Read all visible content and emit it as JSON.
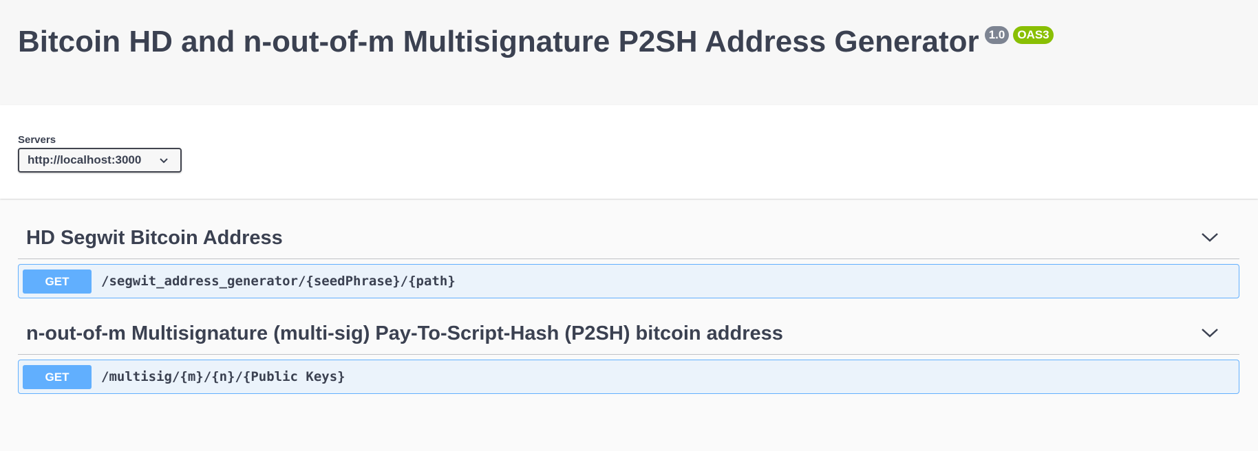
{
  "info": {
    "title": "Bitcoin HD and n-out-of-m Multisignature P2SH Address Generator",
    "version": "1.0",
    "spec_badge": "OAS3"
  },
  "servers": {
    "label": "Servers",
    "selected": "http://localhost:3000"
  },
  "tags": [
    {
      "name": "HD Segwit Bitcoin Address",
      "operations": [
        {
          "method": "GET",
          "path": "/segwit_address_generator/{seedPhrase}/{path}"
        }
      ]
    },
    {
      "name": "n-out-of-m Multisignature (multi-sig) Pay-To-Script-Hash (P2SH) bitcoin address",
      "operations": [
        {
          "method": "GET",
          "path": "/multisig/{m}/{n}/{Public Keys}"
        }
      ]
    }
  ],
  "colors": {
    "get_method": "#61affe",
    "get_background": "#ebf3fb",
    "version_badge": "#7d8492",
    "oas_badge": "#89bf04",
    "text": "#3b4151"
  },
  "icons": {
    "server_dropdown": "chevron-down-icon",
    "tag_toggle": "chevron-down-icon"
  }
}
